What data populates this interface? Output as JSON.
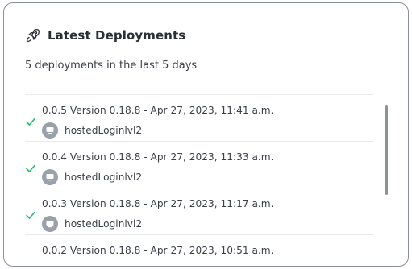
{
  "header": {
    "icon": "rocket-icon",
    "title": "Latest Deployments"
  },
  "subtitle": "5 deployments in the last 5 days",
  "deployments": [
    {
      "label": "0.0.5 Version 0.18.8 - Apr 27, 2023, 11:41 a.m.",
      "host": "hostedLoginlvl2",
      "status": "success",
      "status_icon": "check-icon",
      "avatar_icon": "computer-icon"
    },
    {
      "label": "0.0.4 Version 0.18.8 - Apr 27, 2023, 11:33 a.m.",
      "host": "hostedLoginlvl2",
      "status": "success",
      "status_icon": "check-icon",
      "avatar_icon": "computer-icon"
    },
    {
      "label": "0.0.3 Version 0.18.8 - Apr 27, 2023, 11:17 a.m.",
      "host": "hostedLoginlvl2",
      "status": "success",
      "status_icon": "check-icon",
      "avatar_icon": "computer-icon"
    },
    {
      "label": "0.0.2 Version 0.18.8 - Apr 27, 2023, 10:51 a.m.",
      "host": "",
      "status": "",
      "status_icon": "",
      "avatar_icon": ""
    }
  ],
  "colors": {
    "success": "#2bb673",
    "border": "#8a8f98",
    "avatar": "#9aa1ab",
    "scrollbar": "#8d9199"
  }
}
